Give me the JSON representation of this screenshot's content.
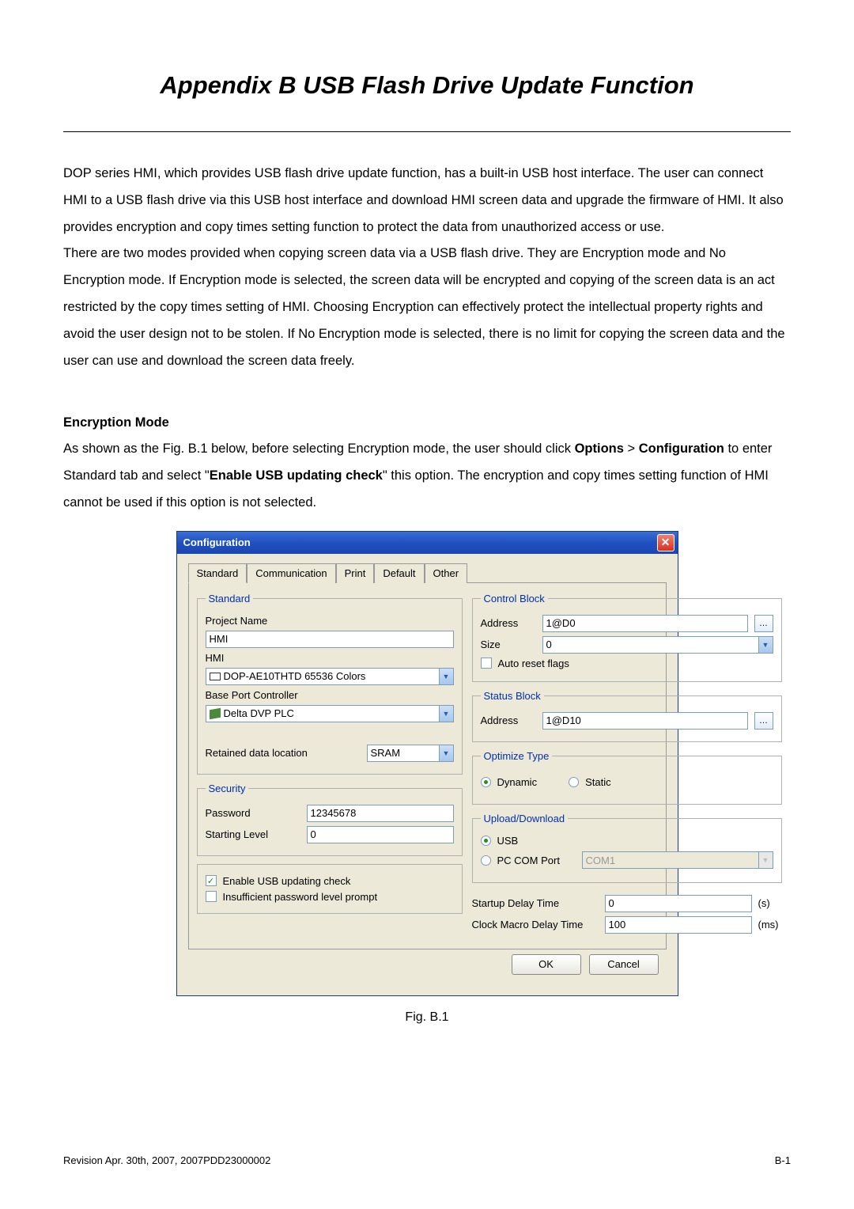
{
  "page": {
    "title": "Appendix B  USB Flash Drive Update Function",
    "para1": "DOP series HMI, which provides USB flash drive update function, has a built-in USB host interface. The user can connect HMI to a USB flash drive via this USB host interface and download HMI screen data and upgrade the firmware of HMI. It also provides encryption and copy times setting function to protect the data from unauthorized access or use.",
    "para2": "There are two modes provided when copying screen data via a USB flash drive. They are Encryption mode and No Encryption mode. If Encryption mode is selected, the screen data will be encrypted and copying of the screen data is an act restricted by the copy times setting of HMI. Choosing Encryption can effectively protect the intellectual property rights and avoid the user design not to be stolen. If No Encryption mode is selected, there is no limit for copying the screen data and the user can use and download the screen data freely.",
    "section_heading": "Encryption Mode",
    "para3a": "As shown as the Fig. B.1 below, before selecting Encryption mode, the user should click ",
    "para3b_bold": "Options",
    "para3c": " > ",
    "para3d_bold": "Configuration",
    "para3e": " to enter Standard tab and select \"",
    "para3f_bold": "Enable USB updating check",
    "para3g": "\" this option. The encryption and copy times setting function of HMI cannot be used if this option is not selected.",
    "figure_caption": "Fig. B.1",
    "footer_left": "Revision Apr. 30th, 2007, 2007PDD23000002",
    "footer_right": "B-1"
  },
  "dialog": {
    "title": "Configuration",
    "tabs": [
      "Standard",
      "Communication",
      "Print",
      "Default",
      "Other"
    ],
    "standard": {
      "legend": "Standard",
      "project_name_label": "Project Name",
      "project_name_value": "HMI",
      "hmi_label": "HMI",
      "hmi_value": "DOP-AE10THTD 65536 Colors",
      "base_port_label": "Base Port Controller",
      "base_port_value": "Delta DVP PLC",
      "retained_label": "Retained data location",
      "retained_value": "SRAM"
    },
    "security": {
      "legend": "Security",
      "password_label": "Password",
      "password_value": "12345678",
      "startlevel_label": "Starting Level",
      "startlevel_value": "0"
    },
    "checks": {
      "usb_label": "Enable USB updating check",
      "usb_checked": true,
      "pwd_label": "Insufficient password level prompt",
      "pwd_checked": false
    },
    "control_block": {
      "legend": "Control Block",
      "address_label": "Address",
      "address_value": "1@D0",
      "size_label": "Size",
      "size_value": "0",
      "autoreset_label": "Auto reset flags",
      "autoreset_checked": false
    },
    "status_block": {
      "legend": "Status Block",
      "address_label": "Address",
      "address_value": "1@D10"
    },
    "optimize": {
      "legend": "Optimize Type",
      "dynamic": "Dynamic",
      "static": "Static"
    },
    "upload": {
      "legend": "Upload/Download",
      "usb": "USB",
      "pc": "PC COM Port",
      "com": "COM1"
    },
    "timing": {
      "startup_label": "Startup Delay Time",
      "startup_value": "0",
      "startup_unit": "(s)",
      "clock_label": "Clock Macro Delay Time",
      "clock_value": "100",
      "clock_unit": "(ms)"
    },
    "buttons": {
      "ok": "OK",
      "cancel": "Cancel"
    }
  }
}
